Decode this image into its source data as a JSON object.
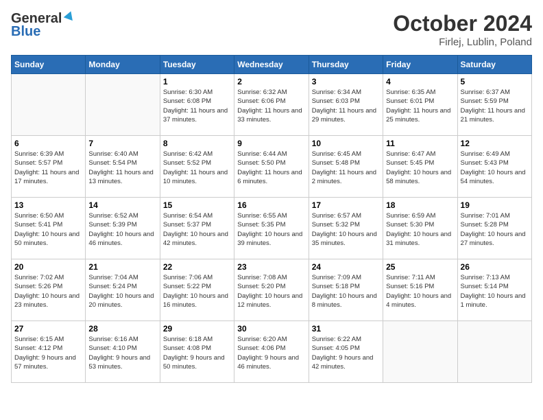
{
  "header": {
    "logo_general": "General",
    "logo_blue": "Blue",
    "month_year": "October 2024",
    "location": "Firlej, Lublin, Poland"
  },
  "weekdays": [
    "Sunday",
    "Monday",
    "Tuesday",
    "Wednesday",
    "Thursday",
    "Friday",
    "Saturday"
  ],
  "weeks": [
    [
      {
        "day": "",
        "info": ""
      },
      {
        "day": "",
        "info": ""
      },
      {
        "day": "1",
        "info": "Sunrise: 6:30 AM\nSunset: 6:08 PM\nDaylight: 11 hours and 37 minutes."
      },
      {
        "day": "2",
        "info": "Sunrise: 6:32 AM\nSunset: 6:06 PM\nDaylight: 11 hours and 33 minutes."
      },
      {
        "day": "3",
        "info": "Sunrise: 6:34 AM\nSunset: 6:03 PM\nDaylight: 11 hours and 29 minutes."
      },
      {
        "day": "4",
        "info": "Sunrise: 6:35 AM\nSunset: 6:01 PM\nDaylight: 11 hours and 25 minutes."
      },
      {
        "day": "5",
        "info": "Sunrise: 6:37 AM\nSunset: 5:59 PM\nDaylight: 11 hours and 21 minutes."
      }
    ],
    [
      {
        "day": "6",
        "info": "Sunrise: 6:39 AM\nSunset: 5:57 PM\nDaylight: 11 hours and 17 minutes."
      },
      {
        "day": "7",
        "info": "Sunrise: 6:40 AM\nSunset: 5:54 PM\nDaylight: 11 hours and 13 minutes."
      },
      {
        "day": "8",
        "info": "Sunrise: 6:42 AM\nSunset: 5:52 PM\nDaylight: 11 hours and 10 minutes."
      },
      {
        "day": "9",
        "info": "Sunrise: 6:44 AM\nSunset: 5:50 PM\nDaylight: 11 hours and 6 minutes."
      },
      {
        "day": "10",
        "info": "Sunrise: 6:45 AM\nSunset: 5:48 PM\nDaylight: 11 hours and 2 minutes."
      },
      {
        "day": "11",
        "info": "Sunrise: 6:47 AM\nSunset: 5:45 PM\nDaylight: 10 hours and 58 minutes."
      },
      {
        "day": "12",
        "info": "Sunrise: 6:49 AM\nSunset: 5:43 PM\nDaylight: 10 hours and 54 minutes."
      }
    ],
    [
      {
        "day": "13",
        "info": "Sunrise: 6:50 AM\nSunset: 5:41 PM\nDaylight: 10 hours and 50 minutes."
      },
      {
        "day": "14",
        "info": "Sunrise: 6:52 AM\nSunset: 5:39 PM\nDaylight: 10 hours and 46 minutes."
      },
      {
        "day": "15",
        "info": "Sunrise: 6:54 AM\nSunset: 5:37 PM\nDaylight: 10 hours and 42 minutes."
      },
      {
        "day": "16",
        "info": "Sunrise: 6:55 AM\nSunset: 5:35 PM\nDaylight: 10 hours and 39 minutes."
      },
      {
        "day": "17",
        "info": "Sunrise: 6:57 AM\nSunset: 5:32 PM\nDaylight: 10 hours and 35 minutes."
      },
      {
        "day": "18",
        "info": "Sunrise: 6:59 AM\nSunset: 5:30 PM\nDaylight: 10 hours and 31 minutes."
      },
      {
        "day": "19",
        "info": "Sunrise: 7:01 AM\nSunset: 5:28 PM\nDaylight: 10 hours and 27 minutes."
      }
    ],
    [
      {
        "day": "20",
        "info": "Sunrise: 7:02 AM\nSunset: 5:26 PM\nDaylight: 10 hours and 23 minutes."
      },
      {
        "day": "21",
        "info": "Sunrise: 7:04 AM\nSunset: 5:24 PM\nDaylight: 10 hours and 20 minutes."
      },
      {
        "day": "22",
        "info": "Sunrise: 7:06 AM\nSunset: 5:22 PM\nDaylight: 10 hours and 16 minutes."
      },
      {
        "day": "23",
        "info": "Sunrise: 7:08 AM\nSunset: 5:20 PM\nDaylight: 10 hours and 12 minutes."
      },
      {
        "day": "24",
        "info": "Sunrise: 7:09 AM\nSunset: 5:18 PM\nDaylight: 10 hours and 8 minutes."
      },
      {
        "day": "25",
        "info": "Sunrise: 7:11 AM\nSunset: 5:16 PM\nDaylight: 10 hours and 4 minutes."
      },
      {
        "day": "26",
        "info": "Sunrise: 7:13 AM\nSunset: 5:14 PM\nDaylight: 10 hours and 1 minute."
      }
    ],
    [
      {
        "day": "27",
        "info": "Sunrise: 6:15 AM\nSunset: 4:12 PM\nDaylight: 9 hours and 57 minutes."
      },
      {
        "day": "28",
        "info": "Sunrise: 6:16 AM\nSunset: 4:10 PM\nDaylight: 9 hours and 53 minutes."
      },
      {
        "day": "29",
        "info": "Sunrise: 6:18 AM\nSunset: 4:08 PM\nDaylight: 9 hours and 50 minutes."
      },
      {
        "day": "30",
        "info": "Sunrise: 6:20 AM\nSunset: 4:06 PM\nDaylight: 9 hours and 46 minutes."
      },
      {
        "day": "31",
        "info": "Sunrise: 6:22 AM\nSunset: 4:05 PM\nDaylight: 9 hours and 42 minutes."
      },
      {
        "day": "",
        "info": ""
      },
      {
        "day": "",
        "info": ""
      }
    ]
  ]
}
